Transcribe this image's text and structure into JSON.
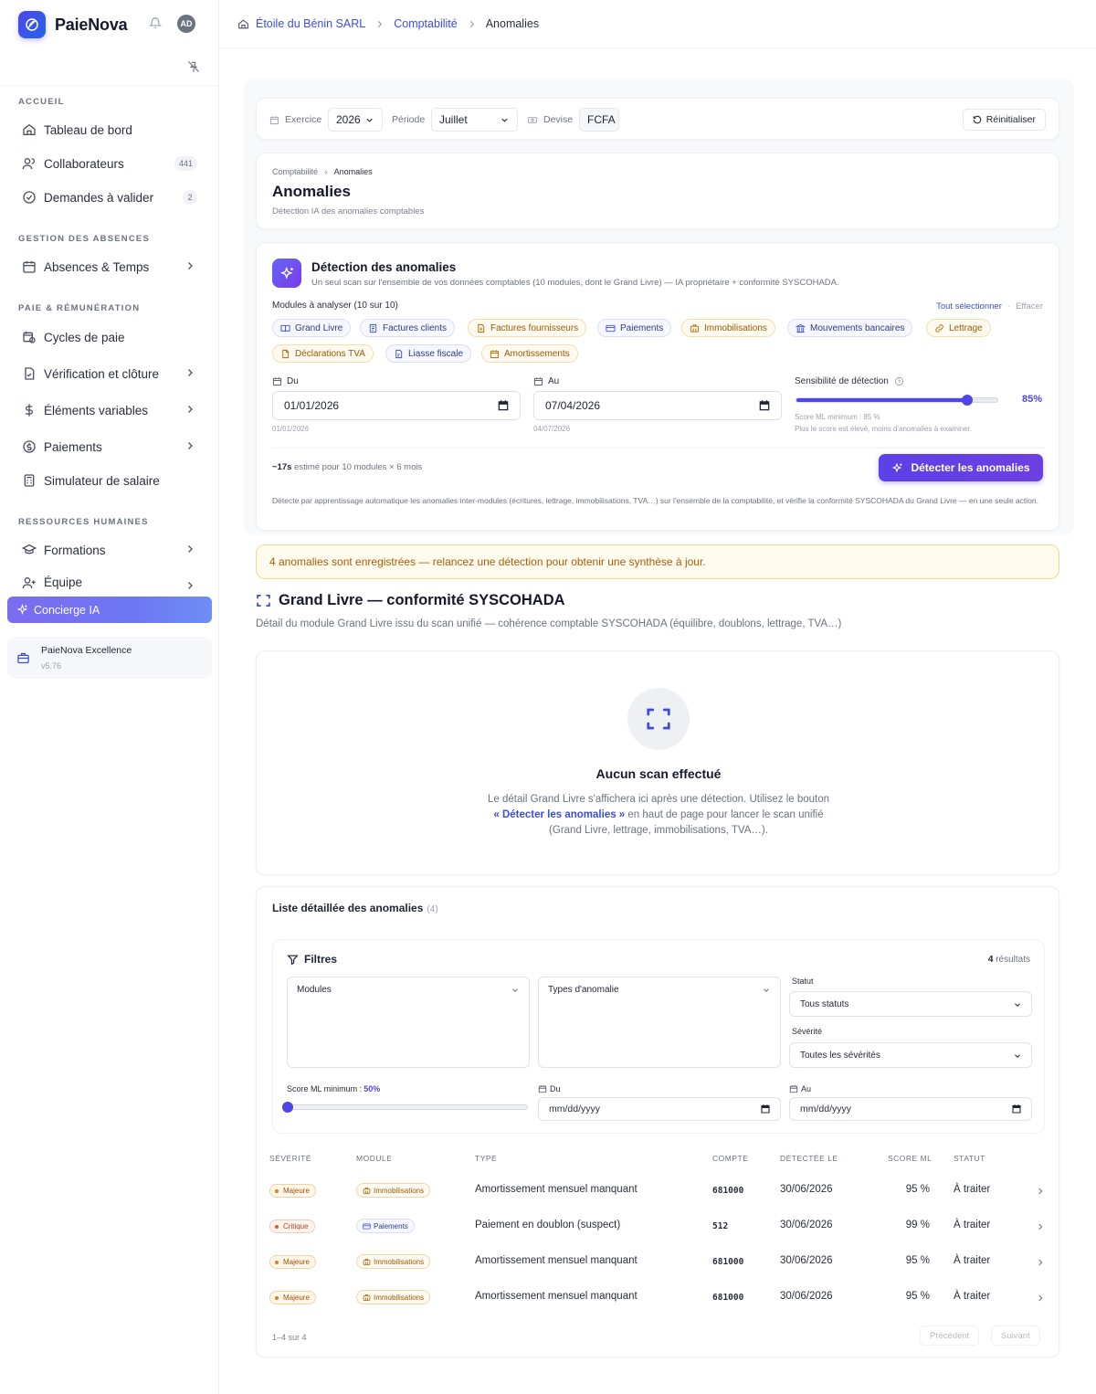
{
  "app": {
    "name": "PaieNova",
    "user_initials": "AD"
  },
  "sidebar": {
    "sections": [
      {
        "label": "ACCUEIL"
      },
      {
        "label": "GESTION DES ABSENCES"
      },
      {
        "label": "PAIE & RÉMUNÉRATION"
      },
      {
        "label": "RESSOURCES HUMAINES"
      }
    ],
    "items": [
      {
        "label": "Tableau de bord",
        "icon": "home-icon"
      },
      {
        "label": "Collaborateurs",
        "icon": "users-icon",
        "badge": "441"
      },
      {
        "label": "Demandes à valider",
        "icon": "check-circle-icon",
        "badge": "2"
      },
      {
        "label": "Absences & Temps",
        "icon": "calendar-icon"
      },
      {
        "label": "Cycles de paie",
        "icon": "calendar-clock-icon"
      },
      {
        "label": "Vérification et clôture",
        "icon": "file-check-icon"
      },
      {
        "label": "Éléments variables",
        "icon": "dollar-icon"
      },
      {
        "label": "Paiements",
        "icon": "coin-icon"
      },
      {
        "label": "Simulateur de salaire",
        "icon": "calculator-icon"
      },
      {
        "label": "Formations",
        "icon": "graduation-cap-icon"
      },
      {
        "label": "Équipe",
        "icon": "user-plus-icon"
      }
    ],
    "concierge": "Concierge IA",
    "excellence": {
      "title": "PaieNova Excellence",
      "version": "v5.76"
    }
  },
  "breadcrumb": [
    "Étoile du Bénin SARL",
    "Comptabilité",
    "Anomalies"
  ],
  "filterbar": {
    "exercice_label": "Exercice",
    "exercice": "2026",
    "periode_label": "Période",
    "periode": "Juillet",
    "devise_label": "Devise",
    "devise": "FCFA",
    "reset": "Réinitialiser"
  },
  "page": {
    "crumb": [
      "Comptabilité",
      "Anomalies"
    ],
    "title": "Anomalies",
    "subtitle": "Détection IA des anomalies comptables"
  },
  "detection": {
    "title": "Détection des anomalies",
    "description": "Un seul scan sur l'ensemble de vos données comptables (10 modules, dont le Grand Livre) — IA propriétaire + conformité SYSCOHADA.",
    "modules_label": "Modules à analyser (10 sur 10)",
    "select_all": "Tout sélectionner",
    "clear": "Effacer",
    "modules": [
      {
        "label": "Grand Livre",
        "tone": "blue"
      },
      {
        "label": "Factures clients",
        "tone": "blue"
      },
      {
        "label": "Factures fournisseurs",
        "tone": "amber"
      },
      {
        "label": "Paiements",
        "tone": "blue"
      },
      {
        "label": "Immobilisations",
        "tone": "amber"
      },
      {
        "label": "Mouvements bancaires",
        "tone": "blue"
      },
      {
        "label": "Lettrage",
        "tone": "amber"
      },
      {
        "label": "Déclarations TVA",
        "tone": "amber"
      },
      {
        "label": "Liasse fiscale",
        "tone": "blue"
      },
      {
        "label": "Amortissements",
        "tone": "amber"
      }
    ],
    "du_label": "Du",
    "du_value": "01/01/2026",
    "du_hint": "01/01/2026",
    "au_label": "Au",
    "au_value": "07/04/2026",
    "au_hint": "04/07/2026",
    "sensitivity_label": "Sensibilité de détection",
    "sensitivity_value": 85,
    "sensitivity_display": "85%",
    "score_min_hint": "Score ML minimum : 85 %",
    "score_hint": "Plus le score est élevé, moins d'anomalies à examiner.",
    "estimate_bold": "~17s",
    "estimate_rest": " estimé pour 10 modules × 6 mois",
    "button": "Détecter les anomalies",
    "footnote": "Détecte par apprentissage automatique les anomalies inter-modules (écritures, lettrage, immobilisations, TVA…) sur l'ensemble de la comptabilité, et vérifie la conformité SYSCOHADA du Grand Livre — en une seule action."
  },
  "alert": "4 anomalies sont enregistrées — relancez une détection pour obtenir une synthèse à jour.",
  "grand_livre": {
    "title": "Grand Livre — conformité SYSCOHADA",
    "subtitle": "Détail du module Grand Livre issu du scan unifié — cohérence comptable SYSCOHADA (équilibre, doublons, lettrage, TVA…)",
    "empty_title": "Aucun scan effectué",
    "empty_text_1": "Le détail Grand Livre s'affichera ici après une détection. Utilisez le bouton ",
    "empty_text_hl": "« Détecter les anomalies »",
    "empty_text_2": " en haut de page pour lancer le scan unifié (Grand Livre, lettrage, immobilisations, TVA…)."
  },
  "list": {
    "title": "Liste détaillée des anomalies",
    "count": "(4)",
    "filters": {
      "title": "Filtres",
      "results_count": "4",
      "results_label": " résultats",
      "modules": "Modules",
      "types": "Types d'anomalie",
      "statut_label": "Statut",
      "statut": "Tous statuts",
      "severite_label": "Sévérité",
      "severite": "Toutes les sévérités",
      "score_label": "Score ML minimum : ",
      "score_value_display": "50%",
      "score_value": 50,
      "du_label": "Du",
      "au_label": "Au",
      "date_placeholder": "mm/dd/yyyy"
    },
    "columns": [
      "SÉVÉRITÉ",
      "MODULE",
      "TYPE",
      "COMPTE",
      "DÉTECTÉE LE",
      "SCORE ML",
      "STATUT"
    ],
    "rows": [
      {
        "severity": "Majeure",
        "sev": "major",
        "module": "Immobilisations",
        "mod": "amber",
        "type": "Amortissement mensuel manquant",
        "account": "681000",
        "date": "30/06/2026",
        "score": "95 %",
        "status": "À traiter"
      },
      {
        "severity": "Critique",
        "sev": "crit",
        "module": "Paiements",
        "mod": "blue",
        "type": "Paiement en doublon (suspect)",
        "account": "512",
        "date": "30/06/2026",
        "score": "99 %",
        "status": "À traiter"
      },
      {
        "severity": "Majeure",
        "sev": "major",
        "module": "Immobilisations",
        "mod": "amber",
        "type": "Amortissement mensuel manquant",
        "account": "681000",
        "date": "30/06/2026",
        "score": "95 %",
        "status": "À traiter"
      },
      {
        "severity": "Majeure",
        "sev": "major",
        "module": "Immobilisations",
        "mod": "amber",
        "type": "Amortissement mensuel manquant",
        "account": "681000",
        "date": "30/06/2026",
        "score": "95 %",
        "status": "À traiter"
      }
    ],
    "pagination": "1–4 sur 4",
    "prev": "Précédent",
    "next": "Suivant"
  },
  "colors": {
    "accent": "#4f46e5",
    "link": "#3b4ce0",
    "warning": "#b25a00"
  }
}
